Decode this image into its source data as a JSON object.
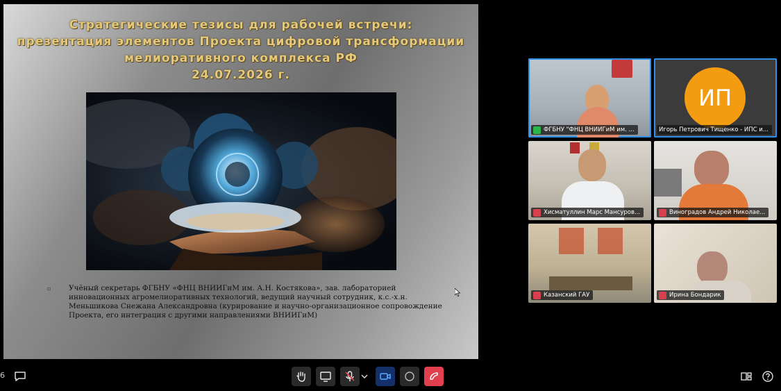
{
  "slide": {
    "title_lines": [
      "Стратегические тезисы для рабочей встречи:",
      "презентация элементов Проекта цифровой трансформации",
      "мелиоративного комплекса РФ",
      "24.07.2026 г."
    ],
    "bullet_symbol": "▫",
    "body_text": "Учёный секретарь ФГБНУ «ФНЦ ВНИИГиМ им. А.Н. Костякова», зав. лабораторией инновационных агромелиоративных технологий, ведущий научный сотрудник, к.с.-х.н. Меньшикова Снежана Александровна (курирование и научно-организационное сопровождение Проекта, его интеграция с другими направлениями ВНИИГиМ)",
    "image_subject": "cloud-in-hand-illustration"
  },
  "participants": [
    {
      "name": "ФГБНУ \"ФНЦ ВНИИГиМ им. ...",
      "muted": false,
      "active": true
    },
    {
      "name": "Игорь Петрович Тищенко - ИПС и...",
      "muted": false,
      "active": true,
      "avatar_initials": "ИП",
      "avatar_color": "#f39c12"
    },
    {
      "name": "Хисматуллин Марс Мансуров...",
      "muted": true,
      "active": false
    },
    {
      "name": "Виноградов Андрей Николае...",
      "muted": true,
      "active": false
    },
    {
      "name": "Казанский ГАУ",
      "muted": true,
      "active": false
    },
    {
      "name": "Ирина Бондарик",
      "muted": true,
      "active": false
    }
  ],
  "toolbar": {
    "left_partial_text": "6",
    "buttons": [
      "chat-icon",
      "raise-hand-icon",
      "screen-share-icon",
      "microphone-muted-icon",
      "chevron-down-icon",
      "camera-icon",
      "record-icon",
      "hang-up-icon",
      "layout-icon",
      "help-icon"
    ]
  },
  "colors": {
    "accent": "#2f8ee8",
    "muted": "#d8404f",
    "hangup": "#e2404f",
    "title": "#e6c87a"
  }
}
